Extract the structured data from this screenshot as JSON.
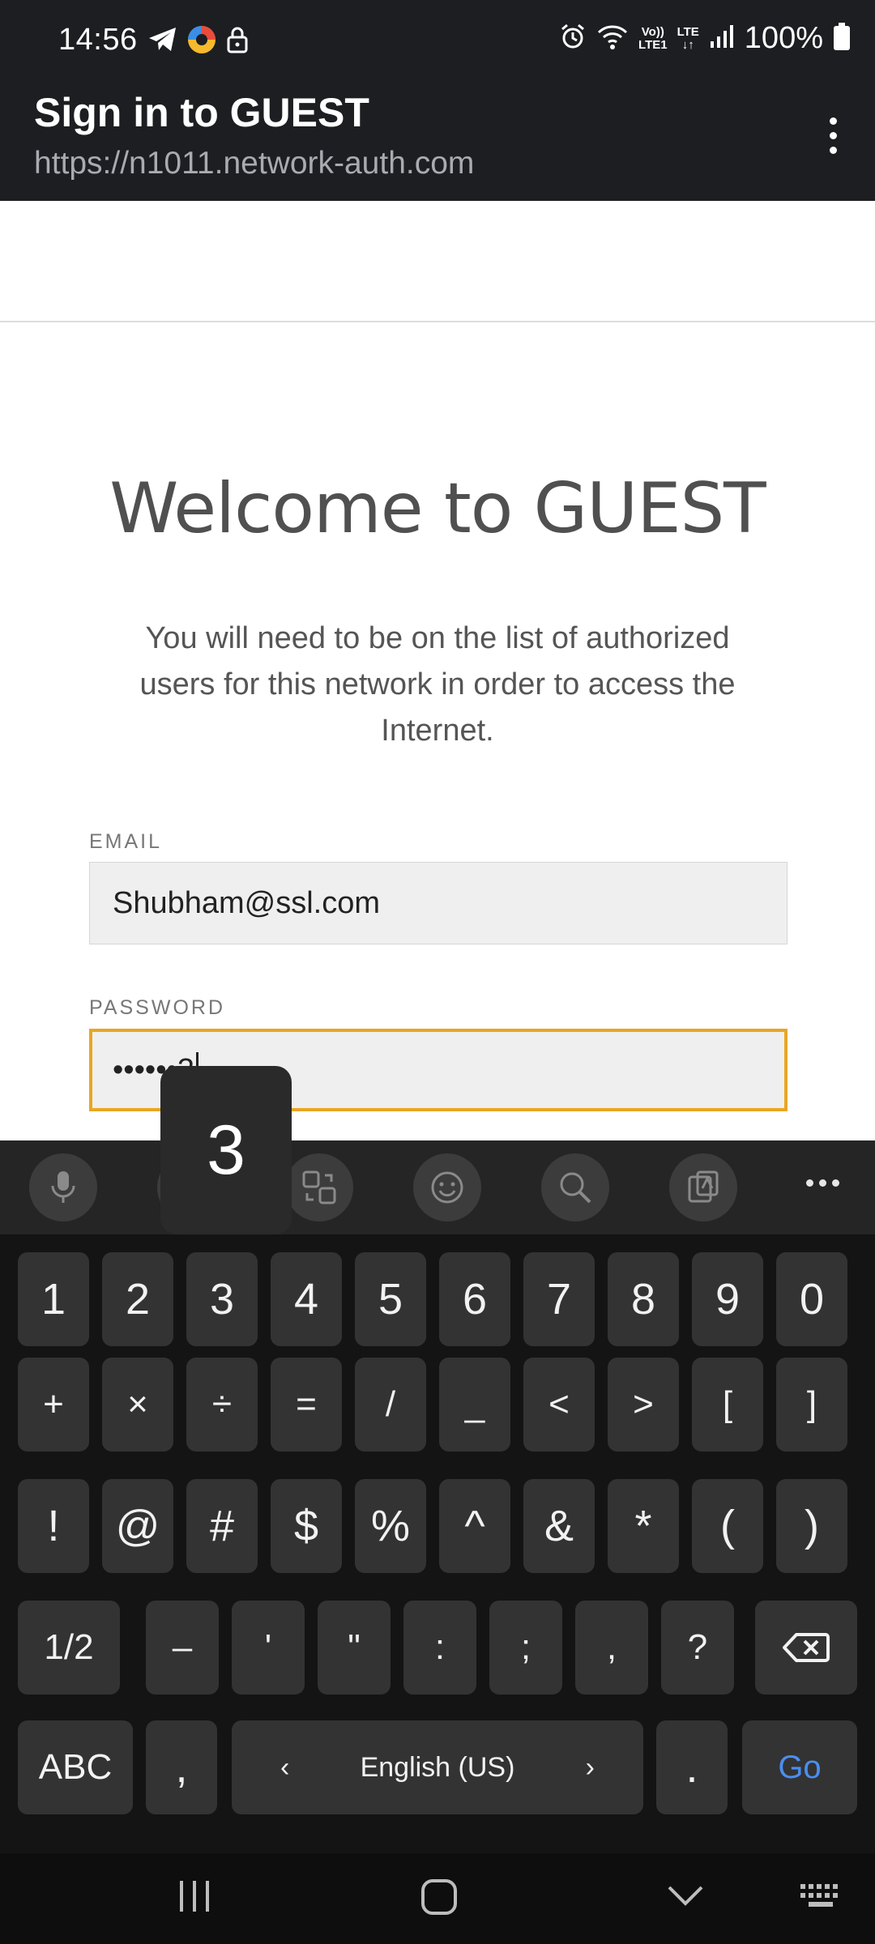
{
  "status_bar": {
    "time": "14:56",
    "network_top": "Vo))",
    "network_bottom": "LTE1",
    "lte_top": "LTE",
    "lte_bottom": "↓↑",
    "battery": "100%"
  },
  "app_bar": {
    "title": "Sign in to GUEST",
    "url": "https://n1011.network-auth.com"
  },
  "page": {
    "heading": "Welcome to GUEST",
    "intro": "You will need to be on the list of authorized users for this network in order to access the Internet.",
    "email_label": "EMAIL",
    "email_value": "Shubham@ssl.com",
    "password_label": "PASSWORD",
    "password_value": "••••••3"
  },
  "key_preview": "3",
  "keyboard": {
    "toolbar_icons": [
      "microphone-icon",
      "clipboard-icon",
      "translate-icon",
      "emoji-icon",
      "search-icon",
      "text-scan-icon",
      "more-icon"
    ],
    "row1": [
      "1",
      "2",
      "3",
      "4",
      "5",
      "6",
      "7",
      "8",
      "9",
      "0"
    ],
    "row2": [
      "+",
      "×",
      "÷",
      "=",
      "/",
      "_",
      "<",
      ">",
      "[",
      "]"
    ],
    "row3": [
      "!",
      "@",
      "#",
      "$",
      "%",
      "^",
      "&",
      "*",
      "(",
      ")"
    ],
    "row4": [
      "1/2",
      "–",
      "'",
      "\"",
      ":",
      ";",
      ",",
      "?"
    ],
    "abc": "ABC",
    "comma": ",",
    "language": "English (US)",
    "lang_prev": "‹",
    "lang_next": "›",
    "period": ".",
    "go": "Go"
  }
}
